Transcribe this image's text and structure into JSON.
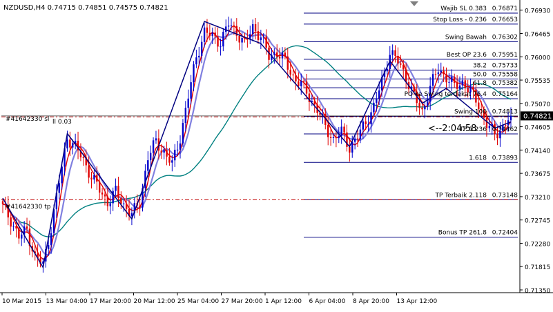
{
  "header": {
    "symbol_info": "NZDUSD,H4  0.74715 0.74851 0.74575 0.74821",
    "dropdown_icon": "triangle-down-icon"
  },
  "countdown": "<--2:04:58",
  "price_axis": {
    "ticks": [
      "0.76930",
      "0.76465",
      "0.76000",
      "0.75535",
      "0.75070",
      "0.74605",
      "0.74140",
      "0.73675",
      "0.73210",
      "0.72745",
      "0.72280",
      "0.71815",
      "0.71350"
    ],
    "current_price_box": "0.74821",
    "current_price_box_color": "#000000"
  },
  "time_axis": {
    "ticks": [
      "10 Mar 2015",
      "13 Mar 04:00",
      "17 Mar 20:00",
      "20 Mar 12:00",
      "25 Mar 04:00",
      "27 Mar 20:00",
      "1 Apr 12:00",
      "6 Apr 04:00",
      "8 Apr 20:00",
      "13 Apr 12:00"
    ]
  },
  "order_labels": {
    "sl": "#41642330 sl",
    "sl_suffix": "ll 0.03",
    "tp": "#41642330 tp"
  },
  "fib_levels": [
    {
      "label": "Wajib SL 0.383",
      "value": "0.76871",
      "price": 0.76871
    },
    {
      "label": "Stop Loss - 0.236",
      "value": "0.76653",
      "price": 0.76653
    },
    {
      "label": "Swing Bawah",
      "value": "0.76302",
      "price": 0.76302
    },
    {
      "label": "Best OP 23.6",
      "value": "0.75951",
      "price": 0.75951
    },
    {
      "label": "38.2",
      "value": "0.75733",
      "price": 0.75733
    },
    {
      "label": "50.0",
      "value": "0.75558",
      "price": 0.75558
    },
    {
      "label": "61.8",
      "value": "0.75382",
      "price": 0.75382
    },
    {
      "label": "PO ke Swing terdekat 76.4",
      "value": "0.75164",
      "price": 0.75164
    },
    {
      "label": "Swing 100",
      "value": "0.74813",
      "price": 0.74813
    },
    {
      "label": "TP 1.236",
      "value": "0.74462",
      "price": 0.74462
    },
    {
      "label": "1.618",
      "value": "0.73893",
      "price": 0.73893
    },
    {
      "label": "TP Terbaik 2.118",
      "value": "0.73148",
      "price": 0.73148
    },
    {
      "label": "Bonus TP 261.8",
      "value": "0.72404",
      "price": 0.72404
    }
  ],
  "colors": {
    "bull_candle": "#0000cc",
    "bear_candle": "#e00000",
    "fib_line": "#000080",
    "zigzag": "#000080",
    "ma_fast": "#e00000",
    "ma_mid": "#8080e0",
    "ma_slow": "#008080",
    "order_line": "#c00000",
    "price_line": "#000000"
  },
  "chart_data": {
    "type": "candlestick",
    "symbol": "NZDUSD",
    "timeframe": "H4",
    "ylim": [
      0.7135,
      0.7705
    ],
    "last": {
      "open": 0.74715,
      "high": 0.74851,
      "low": 0.74575,
      "close": 0.74821
    },
    "current_price": 0.74821,
    "sl_order_price": 0.748,
    "tp_order_price": 0.73148,
    "close_path": [
      [
        0,
        0.73
      ],
      [
        3,
        0.7275
      ],
      [
        6,
        0.724
      ],
      [
        9,
        0.7255
      ],
      [
        12,
        0.72
      ],
      [
        15,
        0.7185
      ],
      [
        18,
        0.726
      ],
      [
        21,
        0.735
      ],
      [
        24,
        0.744
      ],
      [
        27,
        0.742
      ],
      [
        30,
        0.7395
      ],
      [
        33,
        0.736
      ],
      [
        36,
        0.7335
      ],
      [
        39,
        0.731
      ],
      [
        42,
        0.733
      ],
      [
        45,
        0.7305
      ],
      [
        48,
        0.7285
      ],
      [
        51,
        0.731
      ],
      [
        54,
        0.74
      ],
      [
        57,
        0.743
      ],
      [
        60,
        0.741
      ],
      [
        63,
        0.7385
      ],
      [
        66,
        0.744
      ],
      [
        69,
        0.752
      ],
      [
        72,
        0.76
      ],
      [
        75,
        0.765
      ],
      [
        78,
        0.764
      ],
      [
        81,
        0.763
      ],
      [
        84,
        0.7665
      ],
      [
        87,
        0.765
      ],
      [
        90,
        0.7625
      ],
      [
        93,
        0.766
      ],
      [
        96,
        0.764
      ],
      [
        99,
        0.76
      ],
      [
        102,
        0.761
      ],
      [
        105,
        0.759
      ],
      [
        108,
        0.756
      ],
      [
        111,
        0.7545
      ],
      [
        114,
        0.752
      ],
      [
        117,
        0.7495
      ],
      [
        120,
        0.746
      ],
      [
        123,
        0.7435
      ],
      [
        126,
        0.745
      ],
      [
        129,
        0.742
      ],
      [
        132,
        0.744
      ],
      [
        135,
        0.747
      ],
      [
        138,
        0.75
      ],
      [
        141,
        0.755
      ],
      [
        144,
        0.761
      ],
      [
        147,
        0.759
      ],
      [
        150,
        0.756
      ],
      [
        153,
        0.752
      ],
      [
        156,
        0.749
      ],
      [
        159,
        0.754
      ],
      [
        162,
        0.7575
      ],
      [
        165,
        0.756
      ],
      [
        168,
        0.754
      ],
      [
        171,
        0.755
      ],
      [
        174,
        0.753
      ],
      [
        177,
        0.7505
      ],
      [
        180,
        0.7465
      ],
      [
        183,
        0.7445
      ],
      [
        186,
        0.746
      ],
      [
        189,
        0.7482
      ]
    ],
    "bar_count": 190
  }
}
